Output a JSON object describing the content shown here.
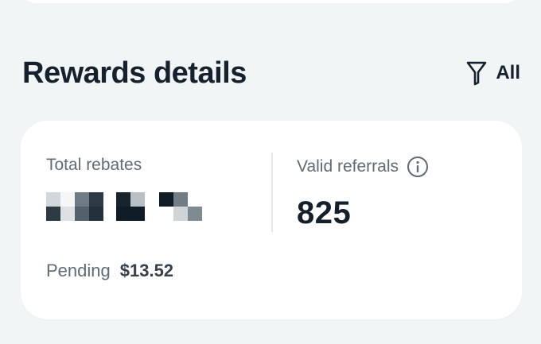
{
  "header": {
    "title": "Rewards details",
    "filter_label": "All",
    "filter_icon": "filter-icon"
  },
  "stats": {
    "total_rebates": {
      "label": "Total rebates",
      "value_masked": true
    },
    "valid_referrals": {
      "label": "Valid referrals",
      "value": "825",
      "info_icon": "info-icon"
    }
  },
  "pending": {
    "label": "Pending",
    "value": "$13.52"
  },
  "colors": {
    "background": "#f2f5f6",
    "card": "#ffffff",
    "text_primary": "#15212c",
    "text_secondary": "#5f6b76"
  }
}
